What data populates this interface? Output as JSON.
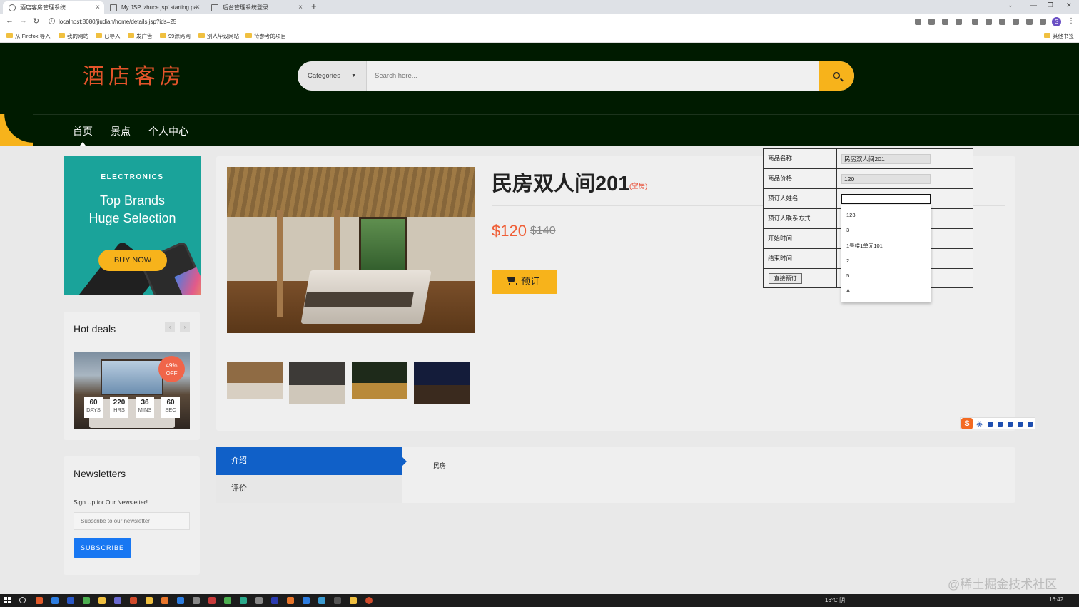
{
  "browser": {
    "tabs": [
      {
        "title": "酒店客房管理系统",
        "active": true
      },
      {
        "title": "My JSP 'zhuce.jsp' starting pa",
        "active": false
      },
      {
        "title": "后台管理系统登录",
        "active": false
      }
    ],
    "new_tab": "+",
    "url": "localhost:8080/jiudian/home/details.jsp?ids=25",
    "profile_initial": "S",
    "bookmarks": [
      "从 Firefox 导入",
      "我的网站",
      "已导入",
      "发广告",
      "99源码网",
      "别人毕设网站",
      "待参考的项目"
    ],
    "other_bookmarks": "其他书签"
  },
  "site": {
    "logo": "酒店客房",
    "search": {
      "category": "Categories",
      "placeholder": "Search here..."
    },
    "nav": [
      "首页",
      "景点",
      "个人中心"
    ]
  },
  "sidebar": {
    "promo": {
      "eyebrow": "ELECTRONICS",
      "headline_line1": "Top Brands",
      "headline_line2": "Huge Selection",
      "button": "BUY NOW"
    },
    "hot_deals": {
      "title": "Hot deals",
      "prev": "‹",
      "next": "›",
      "discount_pct": "49%",
      "discount_off": "OFF",
      "countdown": [
        {
          "value": "60",
          "unit": "DAYS"
        },
        {
          "value": "220",
          "unit": "HRS"
        },
        {
          "value": "36",
          "unit": "MINS"
        },
        {
          "value": "60",
          "unit": "SEC"
        }
      ]
    },
    "newsletter": {
      "title": "Newsletters",
      "description": "Sign Up for Our Newsletter!",
      "placeholder": "Subscribe to our newsletter",
      "button": "SUBSCRIBE"
    }
  },
  "product": {
    "name": "民房双人间201",
    "status": "(空房)",
    "price": "$120",
    "old_price": "$140",
    "book_button": "预订"
  },
  "booking_form": {
    "rows": [
      {
        "label": "商品名称",
        "value": "民房双人间201"
      },
      {
        "label": "商品价格",
        "value": "120"
      },
      {
        "label": "预订人姓名",
        "value": ""
      },
      {
        "label": "预订人联系方式",
        "value": ""
      },
      {
        "label": "开始时间",
        "value": ""
      },
      {
        "label": "结束时间",
        "value": ""
      }
    ],
    "submit": "直接预订",
    "autocomplete": [
      "123",
      "3",
      "1号楼1单元101",
      "2",
      "5",
      "A"
    ]
  },
  "tabs": {
    "active": "介绍",
    "other": "评价",
    "content": "民房"
  },
  "ime": {
    "text": "英"
  },
  "watermark": "@稀土掘金技术社区",
  "taskbar": {
    "weather": "16°C 阴",
    "time": "16:42"
  },
  "colors": {
    "header_bg": "#001b00",
    "accent_yellow": "#f7b31b",
    "price_orange": "#ef5e36",
    "tab_blue": "#1060c8",
    "promo_teal": "#1aa39a",
    "subscribe_blue": "#1877f2"
  }
}
